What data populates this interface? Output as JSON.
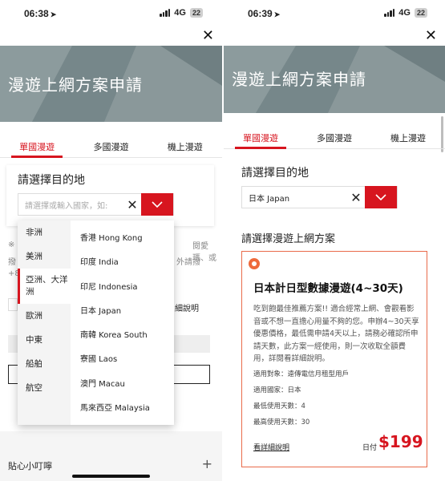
{
  "left": {
    "status": {
      "time": "06:38",
      "network": "4G",
      "battery": "22"
    },
    "title": "漫遊上網方案申請",
    "tabs": [
      "單國漫遊",
      "多國漫遊",
      "機上漫遊"
    ],
    "destination_label": "請選擇目的地",
    "search_placeholder": "請選擇或輸入國家，如:",
    "regions": [
      "非洲",
      "美洲",
      "亞洲、大洋洲",
      "歐洲",
      "中東",
      "船舶",
      "航空"
    ],
    "active_region": "亞洲、大洋洲",
    "countries": [
      "香港 Hong Kong",
      "印度 India",
      "印尼 Indonesia",
      "日本 Japan",
      "南韓 Korea South",
      "寮國 Laos",
      "澳門 Macau",
      "馬來西亞 Malaysia"
    ],
    "bg_fragments": {
      "note_mark": "※",
      "note_mid": "訊",
      "note_right": "閱愛瑪、或",
      "line2_left": "撥",
      "line2_right": "外請撥",
      "line3": "+8",
      "detail": "細說明"
    },
    "tip_label": "貼心小叮嚀",
    "tip_plus": "+"
  },
  "right": {
    "status": {
      "time": "06:39",
      "network": "4G",
      "battery": "22"
    },
    "title": "漫遊上網方案申請",
    "tabs": [
      "單國漫遊",
      "多國漫遊",
      "機上漫遊"
    ],
    "destination_label": "請選擇目的地",
    "search_value": "日本 Japan",
    "plan_heading": "請選擇漫遊上網方案",
    "plan": {
      "title": "日本計日型數據漫遊(4~30天)",
      "description": "吃到飽最佳推薦方案!! 適合經常上網、會觀看影音或不想一直擔心用量不夠的您。申辦4~30天享優惠價格，最低需申請4天以上，請務必確認所申請天數，此方案一經使用，則一次收取全額費用，詳閱看詳細說明。",
      "applicable_users": "適用對象：遠傳電信月租型用戶",
      "applicable_country": "適用國家：日本",
      "min_days": "最低使用天數：4",
      "max_days": "最高使用天數：30",
      "detail_link": "看詳細說明",
      "price_label": "日付",
      "price": "$199"
    }
  },
  "colors": {
    "accent": "#d7151f",
    "banner": "#7f8e90",
    "plan_border": "#e96b4a"
  },
  "icons": [
    "close-icon",
    "chevron-down-icon",
    "clear-icon",
    "plus-icon",
    "location-arrow-icon",
    "signal-icon",
    "battery-icon"
  ]
}
